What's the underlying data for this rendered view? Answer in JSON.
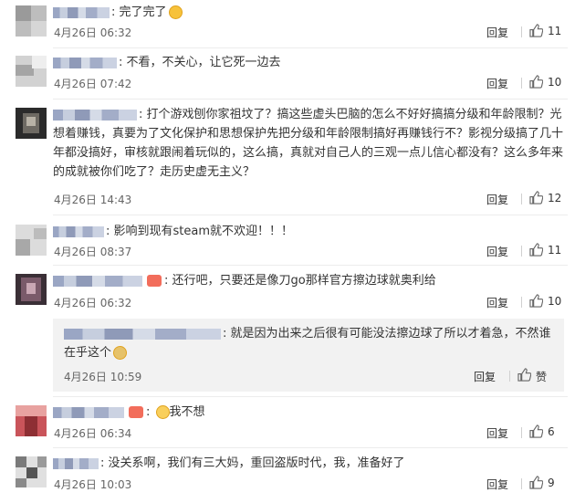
{
  "comments": [
    {
      "sep": ":",
      "text": "完了完了",
      "time": "4月26日 06:32",
      "reply": "回复",
      "likes": "11"
    },
    {
      "sep": ":",
      "text": "不看，不关心，让它死一边去",
      "time": "4月26日 07:42",
      "reply": "回复",
      "likes": "10"
    },
    {
      "sep": ":",
      "text": "打个游戏刨你家祖坟了？搞这些虚头巴脑的怎么不好好搞搞分级和年龄限制？光想着赚钱，真要为了文化保护和思想保护先把分级和年龄限制搞好再赚钱行不？影视分级搞了几十年都没搞好，审核就跟闹着玩似的，这么搞，真就对自己人的三观一点儿信心都没有？这么多年来的成就被你们吃了？走历史虚无主义？",
      "time": "4月26日 14:43",
      "reply": "回复",
      "likes": "12"
    },
    {
      "sep": ":",
      "text": "影响到现有steam就不欢迎！！！",
      "time": "4月26日 08:37",
      "reply": "回复",
      "likes": "11"
    },
    {
      "sep": ":",
      "text": "还行吧，只要还是像刀go那样官方擦边球就奥利给",
      "time": "4月26日 06:32",
      "reply": "回复",
      "likes": "10"
    },
    {
      "sep": ":",
      "text": "我不想",
      "time": "4月26日 06:34",
      "reply": "回复",
      "likes": "6"
    },
    {
      "sep": ":",
      "text": "没关系啊，我们有三大妈，重回盗版时代，我，准备好了",
      "time": "4月26日 10:03",
      "reply": "回复",
      "likes": "9"
    }
  ],
  "nested_reply": {
    "sep": ":",
    "text": "就是因为出来之后很有可能没法擦边球了所以才着急，不然谁在乎这个",
    "time": "4月26日 10:59",
    "reply": "回复",
    "like_label": "赞"
  },
  "colors": {
    "text": "#333333",
    "time": "#666666",
    "nested_bg": "#f2f2f2",
    "emoji": "#f7c23a"
  },
  "icons": {
    "like": "thumbs-up-icon",
    "emoji": "emoji-icon"
  }
}
